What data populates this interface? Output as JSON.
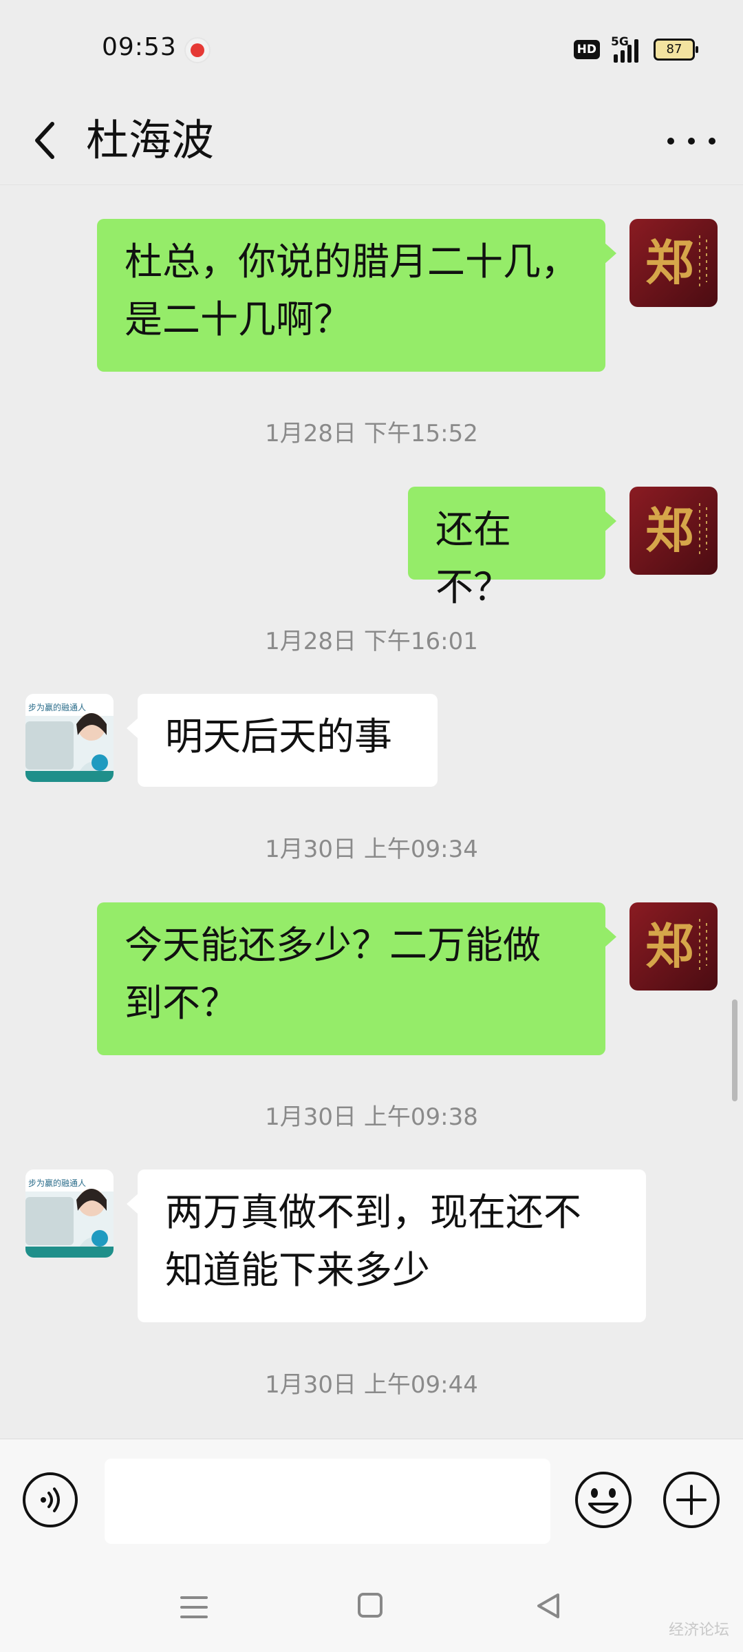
{
  "status_bar": {
    "time": "09:53",
    "network": "5G",
    "hd": "HD",
    "battery": "87"
  },
  "header": {
    "title": "杜海波",
    "back_icon": "chevron-left-icon",
    "more_icon": "more-dots-icon"
  },
  "messages": [
    {
      "direction": "out",
      "text_line1": "杜总，你说的腊月二十几，",
      "text_line2": "是二十几啊？"
    },
    {
      "type": "timestamp",
      "text": "1月28日 下午15:52"
    },
    {
      "direction": "out",
      "text": "还在不？"
    },
    {
      "type": "timestamp",
      "text": "1月28日 下午16:01"
    },
    {
      "direction": "in",
      "text": "明天后天的事"
    },
    {
      "type": "timestamp",
      "text": "1月30日 上午09:34"
    },
    {
      "direction": "out",
      "text_line1": "今天能还多少？二万能做",
      "text_line2": "到不？"
    },
    {
      "type": "timestamp",
      "text": "1月30日 上午09:38"
    },
    {
      "direction": "in",
      "text_line1": "两万真做不到，现在还不",
      "text_line2": "知道能下来多少"
    },
    {
      "type": "timestamp",
      "text": "1月30日 上午09:44"
    }
  ],
  "avatars": {
    "self_char": "郑",
    "contact_sign_text": "步为赢的融通人"
  },
  "input": {
    "value": "",
    "placeholder": ""
  },
  "watermark": "经济论坛",
  "colors": {
    "outgoing_bubble": "#95ec69",
    "incoming_bubble": "#ffffff",
    "background": "#ededed"
  }
}
